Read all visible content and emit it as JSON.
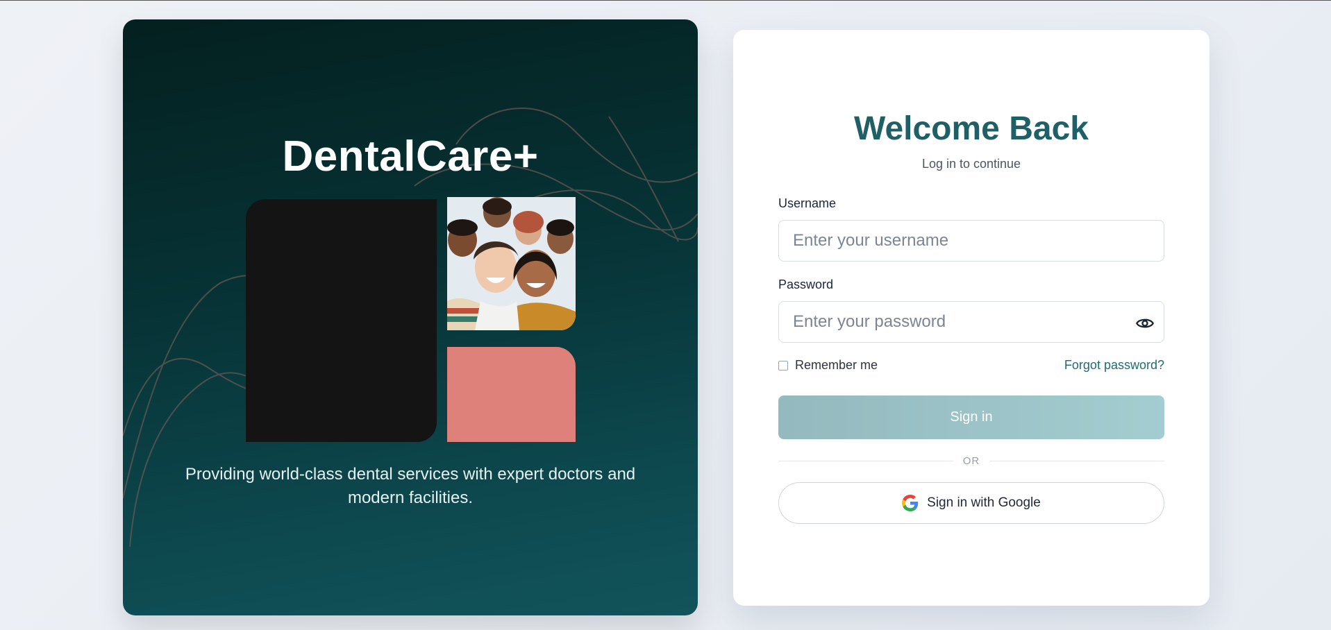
{
  "hero": {
    "brand": "DentalCare+",
    "tagline": "Providing world-class dental services with expert doctors and modern facilities."
  },
  "login": {
    "title": "Welcome Back",
    "subtitle": "Log in to continue",
    "username_label": "Username",
    "username_placeholder": "Enter your username",
    "password_label": "Password",
    "password_placeholder": "Enter your password",
    "remember_label": "Remember me",
    "forgot_label": "Forgot password?",
    "signin_label": "Sign in",
    "divider_label": "OR",
    "google_label": "Sign in with Google"
  },
  "icons": {
    "eye": "eye-icon",
    "google": "google-icon"
  },
  "colors": {
    "hero_bg": "#073437",
    "accent": "#1f5f66",
    "coral_tile": "#df817b",
    "signin_button": "#9fc4c7"
  }
}
